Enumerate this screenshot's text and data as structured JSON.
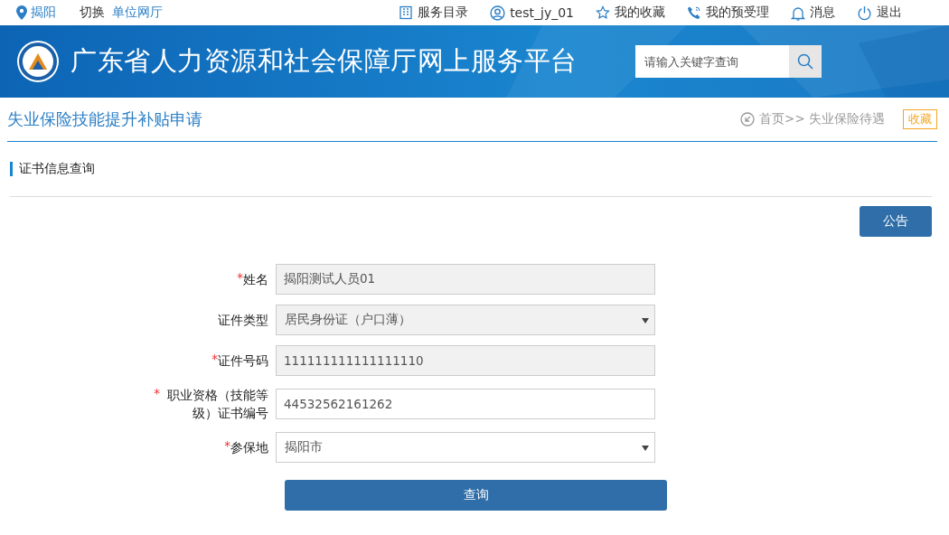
{
  "topbar": {
    "location": "揭阳",
    "switch_label": "切换",
    "switch_target": "单位网厅",
    "links": [
      {
        "kind": "catalog",
        "label": "服务目录"
      },
      {
        "kind": "user",
        "label": "test_jy_01"
      },
      {
        "kind": "star",
        "label": "我的收藏"
      },
      {
        "kind": "phone",
        "label": "我的预受理"
      },
      {
        "kind": "bell",
        "label": "消息"
      },
      {
        "kind": "power",
        "label": "退出"
      }
    ]
  },
  "banner": {
    "title": "广东省人力资源和社会保障厅网上服务平台",
    "search": {
      "placeholder": "请输入关键字查询"
    }
  },
  "page": {
    "title": "失业保险技能提升补贴申请",
    "breadcrumb": "首页>> 失业保险待遇",
    "favorite": "收藏"
  },
  "section": {
    "title": "证书信息查询",
    "notice_button": "公告"
  },
  "form": {
    "fields": [
      {
        "kind": "input",
        "marker": "*",
        "label": "姓名",
        "value": "揭阳测试人员01",
        "disabled": true
      },
      {
        "kind": "select",
        "label": "证件类型",
        "value": "居民身份证（户口薄）",
        "disabled": true
      },
      {
        "kind": "input",
        "marker": "*",
        "label": "证件号码",
        "value": "111111111111111110",
        "disabled": true
      },
      {
        "kind": "input",
        "marker": "*",
        "label": "职业资格（技能等级）证书编号",
        "value": "44532562161262",
        "disabled": false
      },
      {
        "kind": "select",
        "marker": "*",
        "label": "参保地",
        "value": "揭阳市",
        "disabled": false
      }
    ],
    "submit": "查询"
  }
}
